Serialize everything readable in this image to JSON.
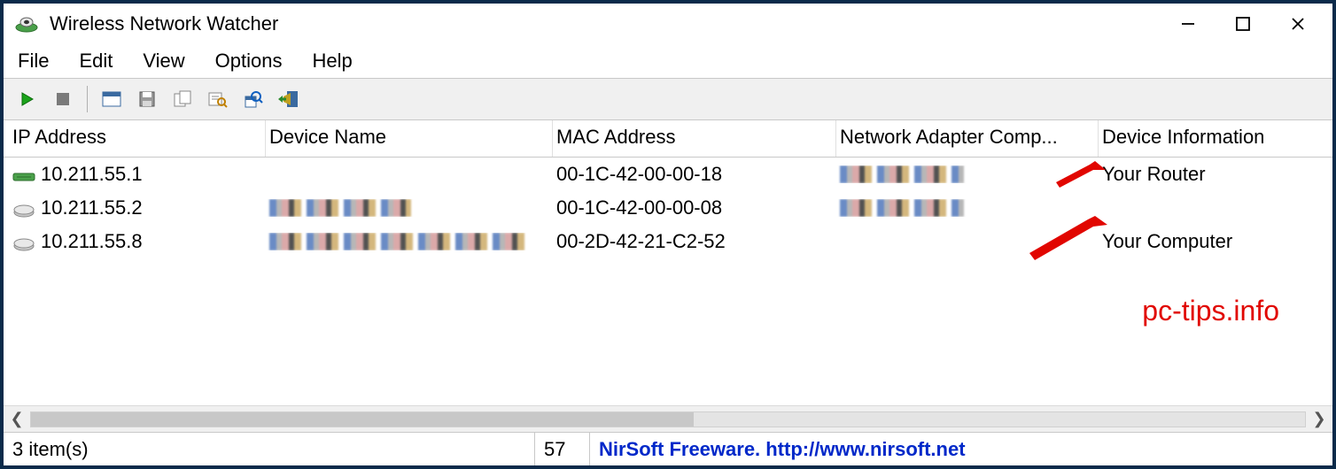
{
  "window": {
    "title": "Wireless Network Watcher"
  },
  "menu": {
    "file": "File",
    "edit": "Edit",
    "view": "View",
    "options": "Options",
    "help": "Help"
  },
  "toolbar_icons": [
    "play",
    "stop",
    "properties",
    "save",
    "copy",
    "find",
    "advanced-options",
    "exit"
  ],
  "columns": {
    "ip": "IP Address",
    "device": "Device Name",
    "mac": "MAC Address",
    "adapter": "Network Adapter Comp...",
    "info": "Device Information"
  },
  "rows": [
    {
      "icon": "router",
      "ip": "10.211.55.1",
      "device": "",
      "mac": "00-1C-42-00-00-18",
      "adapter": "",
      "info": "Your Router",
      "device_blurred": false,
      "adapter_blurred": true
    },
    {
      "icon": "device",
      "ip": "10.211.55.2",
      "device": "",
      "mac": "00-1C-42-00-00-08",
      "adapter": "",
      "info": "",
      "device_blurred": true,
      "adapter_blurred": true
    },
    {
      "icon": "device",
      "ip": "10.211.55.8",
      "device": "",
      "mac": "00-2D-42-21-C2-52",
      "adapter": "",
      "info": "Your Computer",
      "device_blurred": true,
      "adapter_blurred": false
    }
  ],
  "status": {
    "items": "3 item(s)",
    "count": "57",
    "link": "NirSoft Freeware.  http://www.nirsoft.net"
  },
  "watermark": "pc-tips.info"
}
